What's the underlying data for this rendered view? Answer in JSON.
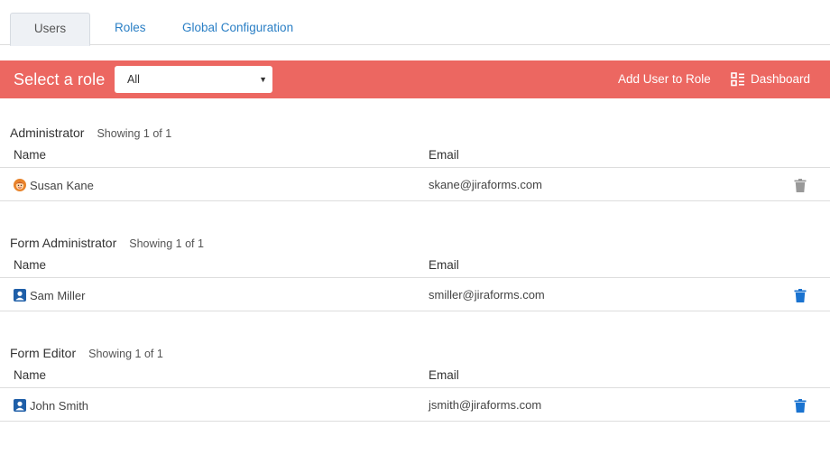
{
  "tabs": [
    {
      "label": "Users",
      "active": true
    },
    {
      "label": "Roles",
      "active": false
    },
    {
      "label": "Global Configuration",
      "active": false
    }
  ],
  "rolebar": {
    "title": "Select a role",
    "select_value": "All",
    "add_user_label": "Add User to Role",
    "dashboard_label": "Dashboard",
    "background_color": "#ec6761"
  },
  "columns": {
    "name": "Name",
    "email": "Email"
  },
  "sections": [
    {
      "role": "Administrator",
      "count": "Showing 1 of 1",
      "users": [
        {
          "name": "Susan Kane",
          "email": "skane@jiraforms.com",
          "avatar": "orange-face-avatar-icon",
          "delete_enabled": false
        }
      ]
    },
    {
      "role": "Form Administrator",
      "count": "Showing 1 of 1",
      "users": [
        {
          "name": "Sam Miller",
          "email": "smiller@jiraforms.com",
          "avatar": "blue-person-avatar-icon",
          "delete_enabled": true
        }
      ]
    },
    {
      "role": "Form Editor",
      "count": "Showing 1 of 1",
      "users": [
        {
          "name": "John Smith",
          "email": "jsmith@jiraforms.com",
          "avatar": "blue-person-avatar-icon",
          "delete_enabled": true
        }
      ]
    }
  ],
  "colors": {
    "link": "#2a7fc5",
    "trash_active": "#1a73d0",
    "trash_disabled": "#999999"
  }
}
